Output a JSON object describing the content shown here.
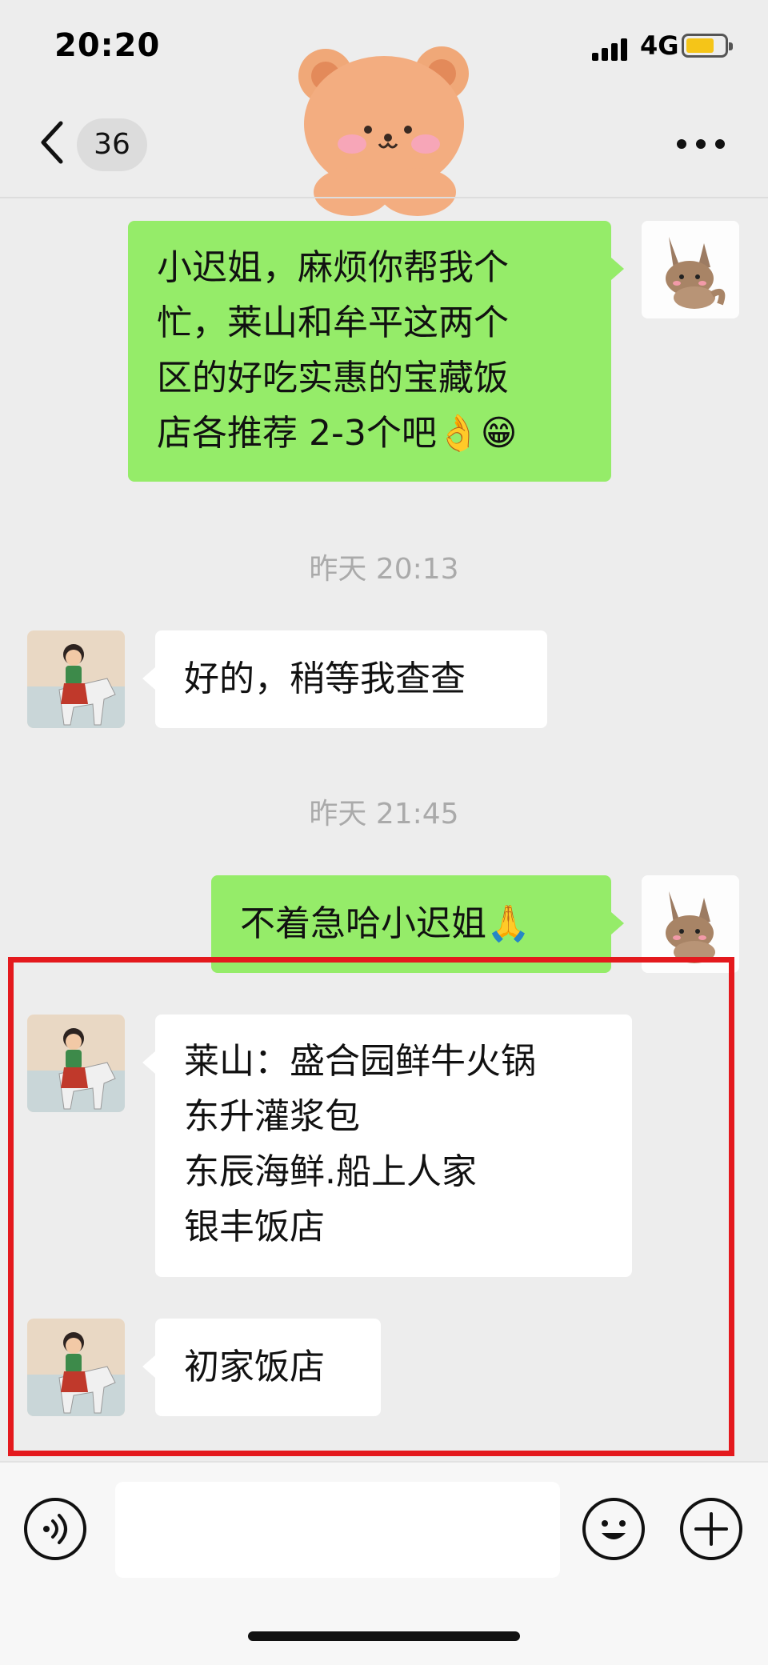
{
  "status_bar": {
    "time": "20:20",
    "network": "4G"
  },
  "nav": {
    "unread_count": "36"
  },
  "messages": [
    {
      "lines": [
        "小迟姐，麻烦你帮我个",
        "忙，莱山和牟平这两个",
        "区的好吃实惠的宝藏饭",
        "店各推荐 2-3个吧👌😁"
      ]
    },
    {
      "timestamp": "昨天 20:13"
    },
    {
      "lines": [
        "好的，稍等我查查"
      ]
    },
    {
      "timestamp": "昨天 21:45"
    },
    {
      "lines": [
        "不着急哈小迟姐🙏"
      ]
    },
    {
      "lines": [
        "莱山：盛合园鲜牛火锅",
        "东升灌浆包",
        "东辰海鲜.船上人家",
        "银丰饭店"
      ]
    },
    {
      "lines": [
        "初家饭店"
      ]
    }
  ],
  "colors": {
    "sent_bubble": "#95ec69",
    "received_bubble": "#ffffff",
    "highlight_box": "#e4191d",
    "background": "#ededed"
  }
}
